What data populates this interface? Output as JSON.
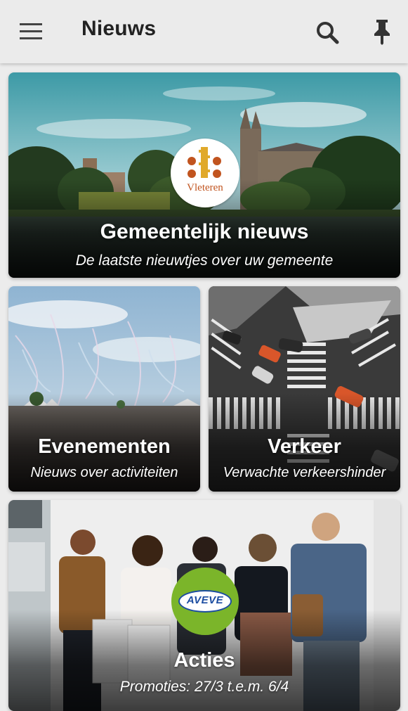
{
  "header": {
    "title": "Nieuws",
    "menu_icon": "hamburger-menu-icon",
    "search_icon": "search-icon",
    "pin_icon": "pin-icon"
  },
  "cards": [
    {
      "id": "gemeentelijk-nieuws",
      "title": "Gemeentelijk nieuws",
      "subtitle": "De laatste nieuwtjes over uw gemeente",
      "logo_text": "Vleteren"
    },
    {
      "id": "evenementen",
      "title": "Evenementen",
      "subtitle": "Nieuws over activiteiten"
    },
    {
      "id": "verkeer",
      "title": "Verkeer",
      "subtitle": "Verwachte verkeershinder"
    },
    {
      "id": "acties",
      "title": "Acties",
      "subtitle": "Promoties: 27/3 t.e.m. 6/4",
      "logo_text": "AVEVE"
    }
  ],
  "colors": {
    "appbar": "#ebebeb",
    "background": "#ececec",
    "vleteren_logo": "#c1541f",
    "aveve_green": "#7bb52a",
    "aveve_blue": "#1c4da1"
  }
}
